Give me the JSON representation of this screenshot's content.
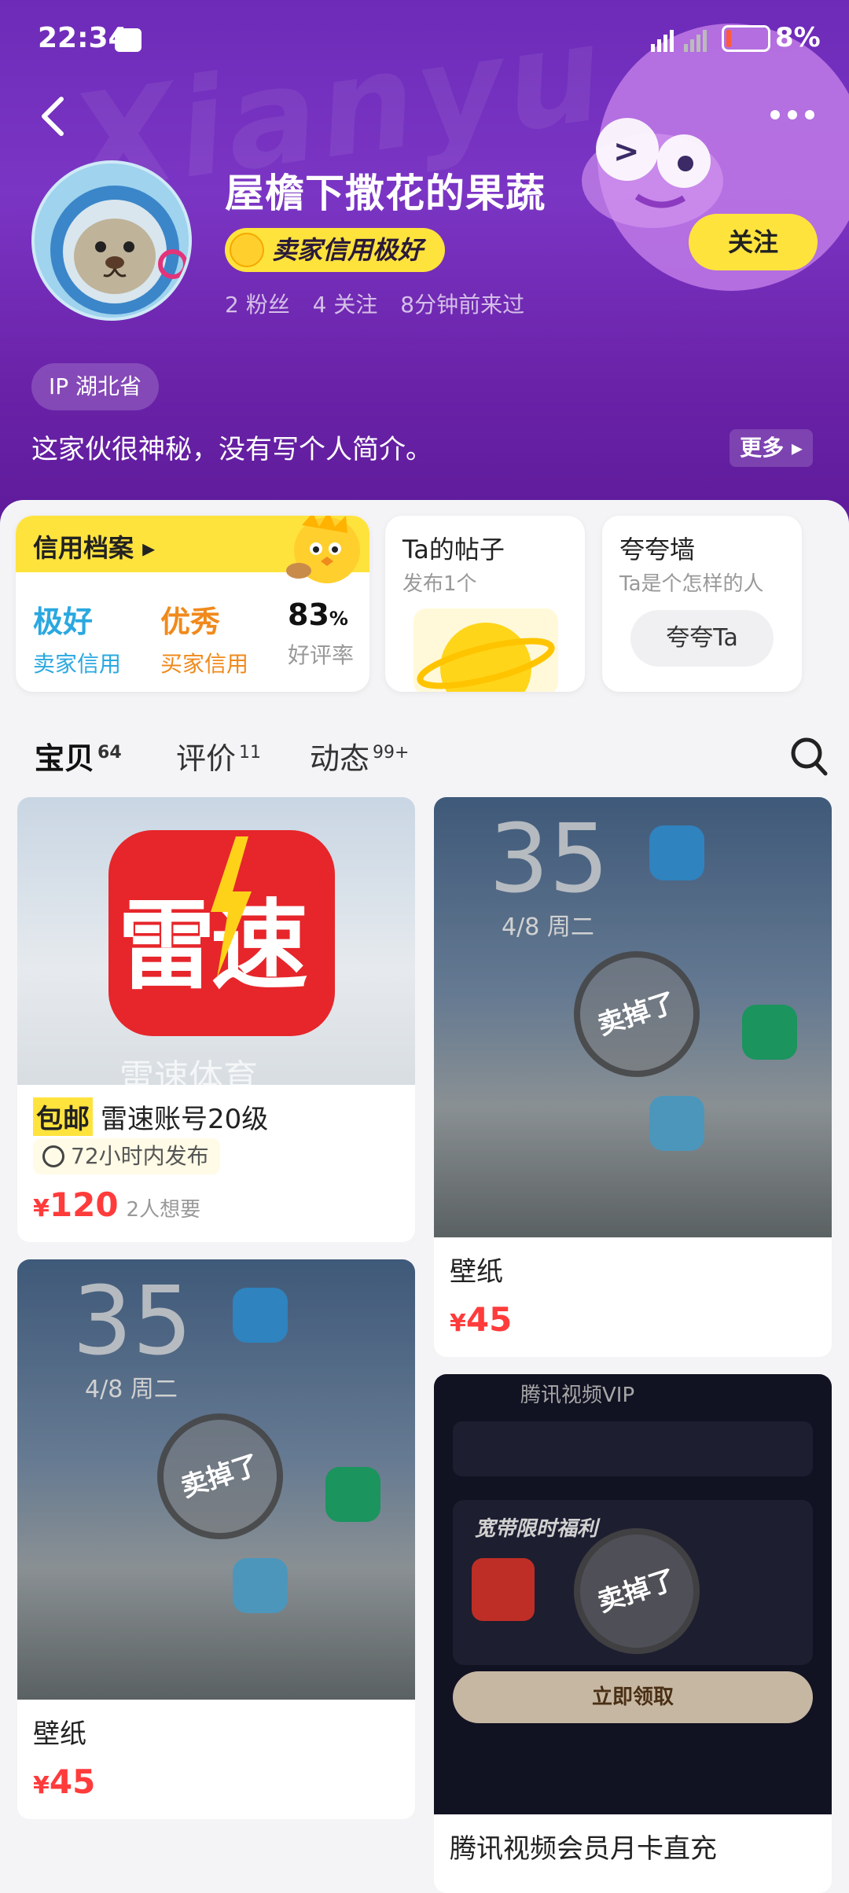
{
  "status_bar": {
    "time": "22:34",
    "battery": "8%"
  },
  "header": {
    "name": "屋檐下撒花的果蔬",
    "credit_badge": "卖家信用极好",
    "fans": "2 粉丝",
    "following": "4 关注",
    "last_seen": "8分钟前来过",
    "follow_button": "关注",
    "ip": "IP 湖北省",
    "bio": "这家伙很神秘，没有写个人简介。",
    "more": "更多"
  },
  "credit_card": {
    "title": "信用档案",
    "seller_value": "极好",
    "seller_label": "卖家信用",
    "buyer_value": "优秀",
    "buyer_label": "买家信用",
    "rate_value": "83",
    "rate_unit": "%",
    "rate_label": "好评率"
  },
  "posts_card": {
    "title": "Ta的帖子",
    "subtitle": "发布1个"
  },
  "praise_card": {
    "title": "夸夸墙",
    "subtitle": "Ta是个怎样的人",
    "button": "夸夸Ta"
  },
  "tabs": [
    {
      "label": "宝贝",
      "count": "64"
    },
    {
      "label": "评价",
      "count": "11"
    },
    {
      "label": "动态",
      "count": "99+"
    }
  ],
  "products": [
    {
      "tag": "包邮",
      "name": "雷速账号20级",
      "time_tag": "72小时内发布",
      "currency": "¥",
      "price": "120",
      "wants": "2人想要",
      "image_text": "雷速",
      "image_subtext": "雷速体育"
    },
    {
      "name": "壁纸",
      "currency": "¥",
      "price": "45",
      "sold": "卖掉了",
      "phone_time": "35",
      "phone_date": "4/8 周二"
    },
    {
      "name": "壁纸",
      "currency": "¥",
      "price": "45",
      "sold": "卖掉了",
      "phone_time": "35",
      "phone_date": "4/8 周二"
    },
    {
      "name": "腾讯视频会员月卡直充",
      "sold": "卖掉了",
      "app_title": "腾讯视频VIP",
      "promo": "宽带限时福利",
      "claim": "立即领取"
    }
  ],
  "colors": {
    "header": "#6d2bb8",
    "accent": "#ffe33d",
    "price": "#ff3b3b",
    "seller_credit": "#2aa8e0",
    "buyer_credit": "#f08a1c"
  }
}
